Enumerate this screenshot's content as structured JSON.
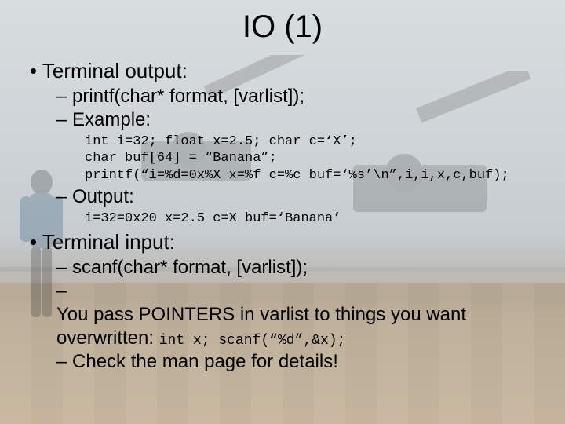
{
  "title": "IO (1)",
  "b1": {
    "heading": "Terminal output:",
    "s1": "printf(char* format, [varlist]);",
    "s2": "Example:",
    "code1": "int i=32; float x=2.5; char c=‘X’;",
    "code2": "char buf[64] = “Banana”;",
    "code3": "printf(“i=%d=0x%X x=%f c=%c buf=‘%s’\\n”,i,i,x,c,buf);",
    "s3": "Output:",
    "out1": "i=32=0x20 x=2.5 c=X buf=‘Banana’"
  },
  "b2": {
    "heading": "Terminal input:",
    "s1": "scanf(char* format, [varlist]);",
    "s2a": "You pass POINTERS in varlist to things you want overwritten: ",
    "s2b": "int x; scanf(“%d”,&x);",
    "s3": "Check the man page for details!"
  }
}
